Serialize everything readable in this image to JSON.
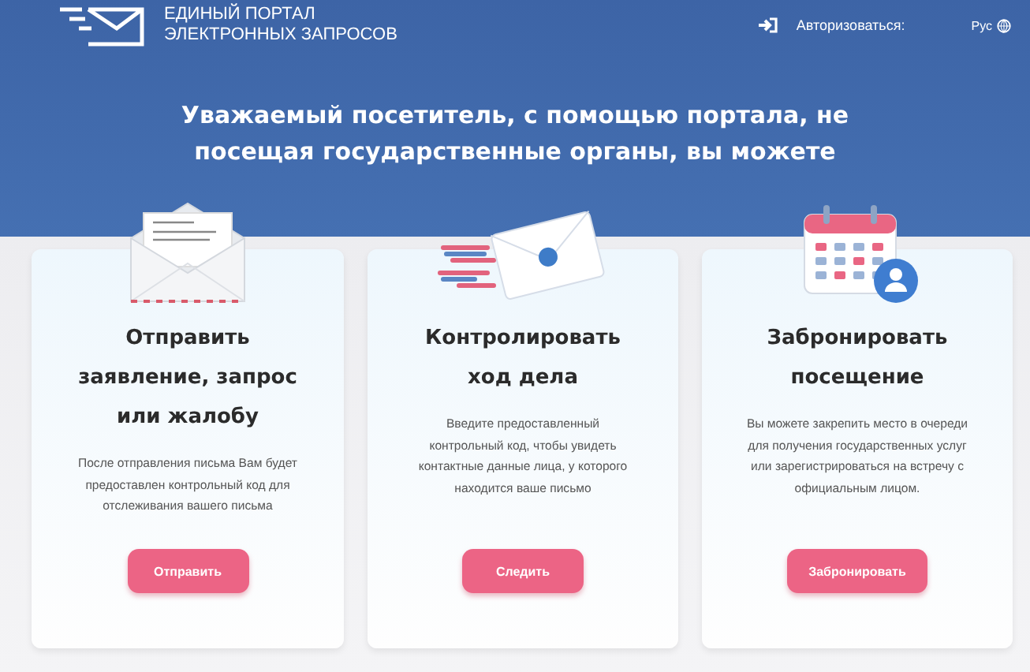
{
  "header": {
    "logo_lines": [
      "ЕДИНЫЙ ПОРТАЛ",
      "ЭЛЕКТРОННЫХ ЗАПРОСОВ"
    ],
    "login": "Авторизоваться:",
    "language": "Рус"
  },
  "hero": {
    "title": "Уважаемый посетитель, с помощью портала, не посещая государственные органы, вы можете"
  },
  "cards": [
    {
      "kind": "letter",
      "title": "Отправить заявление, запрос или жалобу",
      "text": "После отправления письма Вам будет предоставлен контрольный код для отслеживания вашего письма",
      "button": "Отправить"
    },
    {
      "kind": "track",
      "title": "Контролировать ход дела",
      "text": "Введите предоставленный контрольный код, чтобы увидеть контактные данные лица, у которого находится ваше письмо",
      "button": "Следить"
    },
    {
      "kind": "calendar",
      "title": "Забронировать посещение",
      "text": "Вы можете закрепить место в очереди для получения государственных услуг или зарегистрироваться на встречу с официальным лицом.",
      "button": "Забронировать"
    }
  ]
}
